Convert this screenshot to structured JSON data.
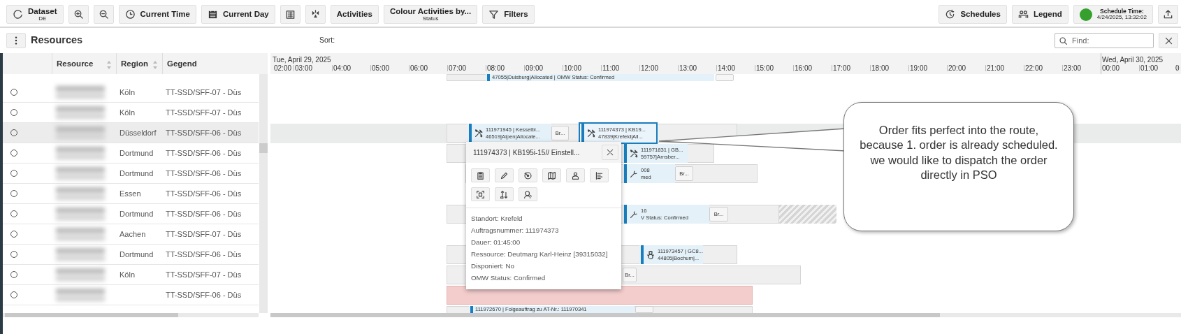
{
  "toolbar_left": [
    {
      "kind": "stacked",
      "label": "Dataset",
      "sub": "DE"
    },
    {
      "kind": "icon"
    },
    {
      "kind": "icon"
    },
    {
      "kind": "text",
      "label": "Current Time"
    },
    {
      "kind": "text",
      "label": "Current Day"
    },
    {
      "kind": "icon"
    },
    {
      "kind": "icon"
    },
    {
      "kind": "text",
      "label": "Activities"
    },
    {
      "kind": "stacked",
      "label": "Colour Activities by...",
      "sub": "Status"
    },
    {
      "kind": "text",
      "label": "Filters"
    }
  ],
  "toolbar_right": [
    {
      "kind": "text",
      "label": "Schedules"
    },
    {
      "kind": "text",
      "label": "Legend"
    },
    {
      "kind": "status",
      "label": "Schedule Time:",
      "sub": "4/24/2025, 13:32:02"
    },
    {
      "kind": "icon"
    }
  ],
  "panel": {
    "title": "Resources",
    "sort_label": "Sort:",
    "find_placeholder": "Find:"
  },
  "columns": [
    {
      "label": "Resource",
      "sortable": true
    },
    {
      "label": "Region",
      "sortable": true
    },
    {
      "label": "Gegend",
      "sortable": false
    }
  ],
  "resources": [
    {
      "region": "Köln",
      "gegend": "TT-SSD/SFF-07 - Düs",
      "selected": false
    },
    {
      "region": "Köln",
      "gegend": "TT-SSD/SFF-07 - Düs",
      "selected": false
    },
    {
      "region": "Düsseldorf",
      "gegend": "TT-SSD/SFF-06 - Düs",
      "selected": true
    },
    {
      "region": "Dortmund",
      "gegend": "TT-SSD/SFF-06 - Düs",
      "selected": false
    },
    {
      "region": "Dortmund",
      "gegend": "TT-SSD/SFF-06 - Düs",
      "selected": false
    },
    {
      "region": "Essen",
      "gegend": "TT-SSD/SFF-06 - Düs",
      "selected": false
    },
    {
      "region": "Dortmund",
      "gegend": "TT-SSD/SFF-06 - Düs",
      "selected": false
    },
    {
      "region": "Aachen",
      "gegend": "TT-SSD/SFF-07 - Düs",
      "selected": false
    },
    {
      "region": "Dortmund",
      "gegend": "TT-SSD/SFF-06 - Düs",
      "selected": false
    },
    {
      "region": "Köln",
      "gegend": "TT-SSD/SFF-07 - Düs",
      "selected": false
    },
    {
      "gegend": "TT-SSD/SFF-06 - Düs",
      "selected": false
    }
  ],
  "timeline": {
    "dates": [
      "Tue, April 29, 2025",
      "Wed, April 30, 2025"
    ],
    "hours": [
      "02:00",
      "03:00",
      "04:00",
      "05:00",
      "06:00",
      "07:00",
      "08:00",
      "09:00",
      "10:00",
      "11:00",
      "12:00",
      "13:00",
      "14:00",
      "15:00",
      "16:00",
      "17:00",
      "18:00",
      "19:00",
      "20:00",
      "21:00",
      "22:00",
      "23:00",
      "00:00",
      "01:00",
      "0"
    ]
  },
  "gantt_rows": [
    {
      "items": [
        {
          "kind": "track"
        },
        {
          "kind": "plain-job",
          "lines": [
            "47055|Duisburg|Allocated | OMW Status: Confirmed"
          ],
          "selected": false
        },
        {
          "kind": "break"
        }
      ]
    },
    {
      "items": []
    },
    {
      "items": []
    },
    {
      "items": [
        {
          "kind": "track"
        },
        {
          "kind": "tool-job",
          "lines": [
            "111971945 | Kesselbl...",
            "46519|Alpen|Allocate..."
          ],
          "selected": false
        },
        {
          "kind": "break",
          "text": "Br..."
        },
        {
          "kind": "tool-job",
          "lines": [
            "111974373 | KB19...",
            "47839|Krefeld|All..."
          ],
          "selected": true
        }
      ]
    },
    {
      "items": [
        {
          "kind": "track"
        },
        {
          "kind": "tool-job",
          "lines": [
            "111971831 | GB...",
            "59757|Arnsber..."
          ],
          "selected": false
        }
      ]
    },
    {
      "items": [
        {
          "kind": "track"
        },
        {
          "kind": "plain-job",
          "lines": [
            "008",
            "med"
          ],
          "selected": false
        },
        {
          "kind": "break",
          "text": "Br..."
        }
      ]
    },
    {
      "items": []
    },
    {
      "items": [
        {
          "kind": "track"
        },
        {
          "kind": "plain-job",
          "lines": [
            "16",
            "V Status: Confirmed"
          ],
          "selected": false
        },
        {
          "kind": "break",
          "text": "Br..."
        },
        {
          "kind": "hatched"
        }
      ]
    },
    {
      "items": []
    },
    {
      "items": [
        {
          "kind": "track"
        },
        {
          "kind": "cold-job",
          "lines": [
            "111973457 | GC8...",
            "44805|Bochum|..."
          ],
          "selected": false
        }
      ]
    },
    {
      "items": [
        {
          "kind": "track"
        },
        {
          "kind": "break",
          "text": "Br..."
        }
      ]
    },
    {
      "items": [
        {
          "kind": "conflict"
        }
      ]
    },
    {
      "items": [
        {
          "kind": "track"
        },
        {
          "kind": "plain-job",
          "lines": [
            "111972670 | Folgeauftrag zu AT-Nr.: 111970341"
          ],
          "selected": false
        },
        {
          "kind": "break"
        }
      ]
    }
  ],
  "popup": {
    "title": "111974373 | KB195i-15// Einstell...",
    "details": [
      "Standort: Krefeld",
      "Auftragsnummer: 111974373",
      "Dauer: 01:45:00",
      "Ressource: Deutmarg Karl-Heinz [39315032]",
      "Disponiert: No",
      "OMW Status: Confirmed"
    ]
  },
  "note": "Order fits perfect into the route, because 1. order is already scheduled. we would like to dispatch the order directly in PSO"
}
